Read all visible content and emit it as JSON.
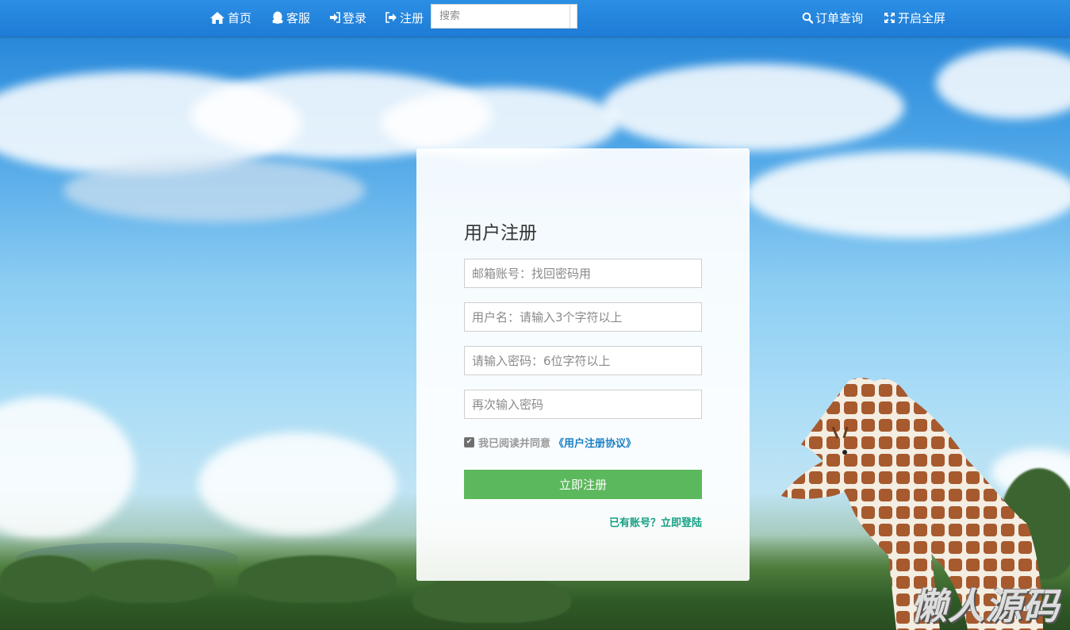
{
  "nav": {
    "home": "首页",
    "service": "客服",
    "login": "登录",
    "register": "注册",
    "search_placeholder": "搜索",
    "order_query": "订单查询",
    "fullscreen": "开启全屏"
  },
  "form": {
    "title": "用户注册",
    "email_placeholder": "邮箱账号：找回密码用",
    "username_placeholder": "用户名：请输入3个字符以上",
    "password_placeholder": "请输入密码：6位字符以上",
    "confirm_placeholder": "再次输入密码",
    "agree_text": "我已阅读并同意",
    "agree_link": "《用户注册协议》",
    "agree_checked": true,
    "submit_label": "立即注册",
    "login_link": "已有账号？立即登陆"
  },
  "watermark": "懒人源码",
  "colors": {
    "topbar": "#1e7bd6",
    "submit": "#5cb85c",
    "agree_link": "#1c7fc4",
    "login_link": "#17a085"
  },
  "icons": [
    "home-icon",
    "qq-icon",
    "sign-in-icon",
    "sign-out-icon",
    "search-icon",
    "expand-icon",
    "check-icon"
  ]
}
